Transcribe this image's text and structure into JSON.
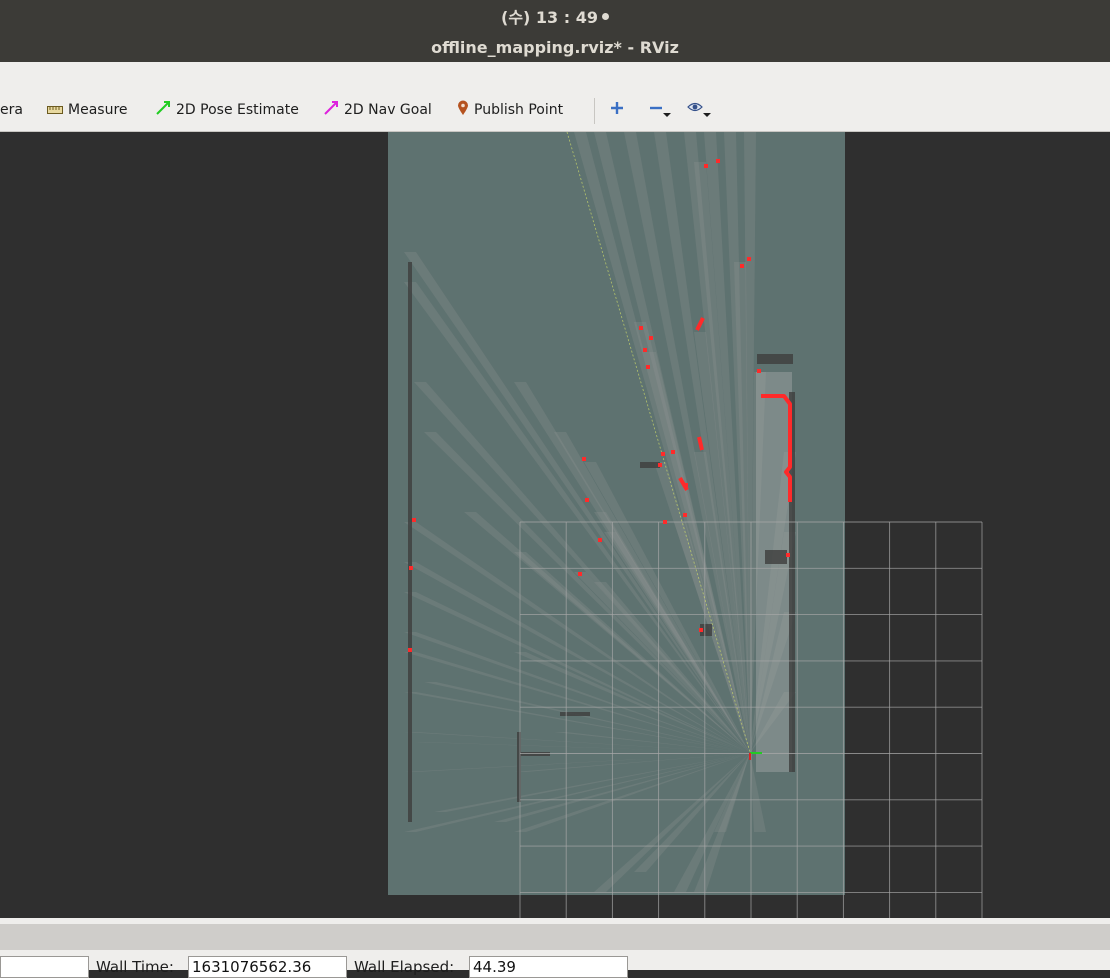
{
  "system": {
    "clock": "(수) 13 : 49"
  },
  "window": {
    "title": "offline_mapping.rviz* - RViz"
  },
  "toolbar": {
    "tools": [
      {
        "label": "era",
        "icon": "camera-icon"
      },
      {
        "label": "Measure",
        "icon": "ruler-icon"
      },
      {
        "label": "2D Pose Estimate",
        "icon": "green-arrow-icon"
      },
      {
        "label": "2D Nav Goal",
        "icon": "magenta-arrow-icon"
      },
      {
        "label": "Publish Point",
        "icon": "map-pin-icon"
      }
    ],
    "view_controls": [
      "plus-icon",
      "minus-icon",
      "eye-icon"
    ]
  },
  "colors": {
    "map_free": "#5e7270",
    "background": "#2f2f2f",
    "laser_points": "#ff2a2a",
    "grid": "#a0a0a0",
    "pose_estimate": "#22dd22",
    "nav_goal": "#dd22dd"
  },
  "status": {
    "wall_time_label": "Wall Time:",
    "wall_time_value": "1631076562.36",
    "wall_elapsed_label": "Wall Elapsed:",
    "wall_elapsed_value": "44.39"
  }
}
